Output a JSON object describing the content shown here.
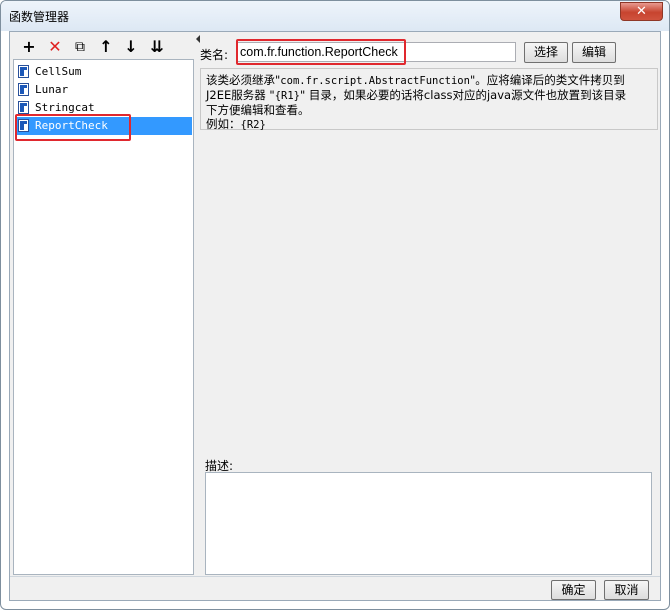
{
  "window": {
    "title": "函数管理器",
    "close_glyph": "✕"
  },
  "toolbar": {
    "add": "+",
    "delete": "✕",
    "copy": "⧉",
    "move_up": "↑",
    "move_down": "↓",
    "sort": "⇊"
  },
  "functions": [
    {
      "name": "CellSum"
    },
    {
      "name": "Lunar"
    },
    {
      "name": "Stringcat"
    },
    {
      "name": "ReportCheck",
      "selected": true
    }
  ],
  "detail": {
    "class_label": "类名:",
    "class_value": "com.fr.function.ReportCheck",
    "choose_button": "选择",
    "edit_button": "编辑",
    "info_line1_a": "该类必须继承\"",
    "info_line1_code": "com.fr.script.AbstractFunction",
    "info_line1_b": "\"。应将编译后的类文件拷贝到",
    "info_line2_a": "J2EE服务器 \"",
    "info_line2_code": "{R1}",
    "info_line2_b": "\" 目录，如果必要的话将class对应的java源文件也放置到该目录",
    "info_line3": "下方便编辑和查看。",
    "info_line4_a": "例如：",
    "info_line4_code": "{R2}",
    "description_label": "描述:",
    "description_value": ""
  },
  "footer": {
    "ok_button": "确定",
    "cancel_button": "取消"
  },
  "colors": {
    "selection": "#3399ff",
    "annotation": "#e0282e"
  }
}
